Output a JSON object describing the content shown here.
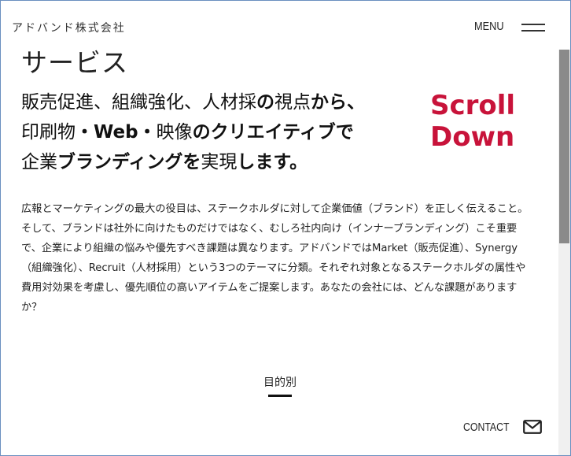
{
  "header": {
    "brand": "アドバンド株式会社",
    "menu_label": "MENU"
  },
  "section": {
    "title": "サービス",
    "lead": [
      [
        {
          "t": "販売促進、組織強化、人材採",
          "b": false
        },
        {
          "t": "の",
          "b": true
        },
        {
          "t": "視点",
          "b": false
        },
        {
          "t": "から、",
          "b": true
        }
      ],
      [
        {
          "t": "印刷物",
          "b": false
        },
        {
          "t": "・Web・",
          "b": true
        },
        {
          "t": "映像",
          "b": false
        },
        {
          "t": "のクリエイティブで",
          "b": true
        }
      ],
      [
        {
          "t": "企業",
          "b": false
        },
        {
          "t": "ブランディングを",
          "b": true
        },
        {
          "t": "実現",
          "b": false
        },
        {
          "t": "します。",
          "b": true
        }
      ]
    ],
    "scroll_hint": [
      "Scroll",
      "Down"
    ],
    "body": "広報とマーケティングの最大の役目は、ステークホルダに対して企業価値（ブランド）を正しく伝えること。そして、ブランドは社外に向けたものだけではなく、むしろ社内向け（インナーブランディング）こそ重要で、企業により組織の悩みや優先すべき課題は異なります。アドバンドではMarket（販売促進）、Synergy（組織強化）、Recruit（人材採用）という3つのテーマに分類。それぞれ対象となるステークホルダの属性や費用対効果を考慮し、優先順位の高いアイテムをご提案します。あなたの会社には、どんな課題がありますか？"
  },
  "tabs": {
    "active_label": "目的別"
  },
  "footer": {
    "contact_label": "CONTACT"
  },
  "icons": {
    "menu": "hamburger-icon",
    "contact": "mail-icon"
  },
  "colors": {
    "accent": "#c8133a",
    "text": "#222222"
  }
}
